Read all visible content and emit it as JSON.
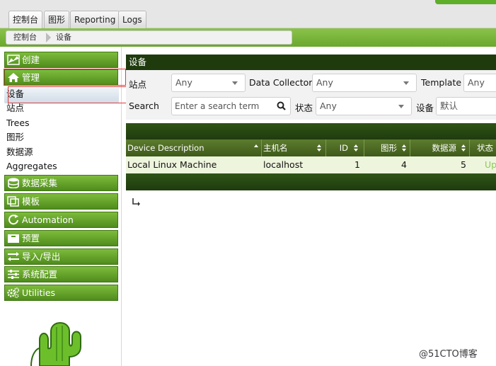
{
  "top_tabs": [
    {
      "label": "控制台"
    },
    {
      "label": "图形"
    },
    {
      "label": "Reporting"
    },
    {
      "label": "Logs"
    }
  ],
  "breadcrumb": [
    {
      "label": "控制台"
    },
    {
      "label": "设备"
    }
  ],
  "sidebar": {
    "sections": [
      {
        "label": "创建",
        "icon": "chart-icon"
      },
      {
        "label": "管理",
        "icon": "home-icon"
      },
      {
        "label": "数据采集",
        "icon": "database-icon"
      },
      {
        "label": "模板",
        "icon": "template-icon"
      },
      {
        "label": "Automation",
        "icon": "automation-icon"
      },
      {
        "label": "预置",
        "icon": "preset-icon"
      },
      {
        "label": "导入/导出",
        "icon": "import-export-icon"
      },
      {
        "label": "系统配置",
        "icon": "settings-sliders-icon"
      },
      {
        "label": "Utilities",
        "icon": "gears-icon"
      }
    ],
    "manage_items": [
      {
        "label": "设备"
      },
      {
        "label": "站点"
      },
      {
        "label": "Trees"
      },
      {
        "label": "图形"
      },
      {
        "label": "数据源"
      },
      {
        "label": "Aggregates"
      }
    ]
  },
  "main": {
    "title": "设备",
    "filters": {
      "site_label": "站点",
      "site_value": "Any",
      "collector_label": "Data Collector",
      "collector_value": "Any",
      "template_label": "Template",
      "template_value": "Any",
      "search_label": "Search",
      "search_placeholder": "Enter a search term",
      "status_label": "状态",
      "status_value": "Any",
      "device_label": "设备",
      "device_value": "默认"
    },
    "table": {
      "columns": [
        "Device Description",
        "主机名",
        "ID",
        "图形",
        "数据源",
        "状态"
      ],
      "rows": [
        {
          "description": "Local Linux Machine",
          "hostname": "localhost",
          "id": "1",
          "graphs": "4",
          "datasources": "5",
          "status": "Up"
        }
      ]
    }
  },
  "watermark": "@51CTO博客",
  "colors": {
    "accent_green": "#5fae2a",
    "dark_green": "#1f3b0e",
    "highlight_red": "#e23b3b",
    "status_up": "#8fc85a"
  }
}
